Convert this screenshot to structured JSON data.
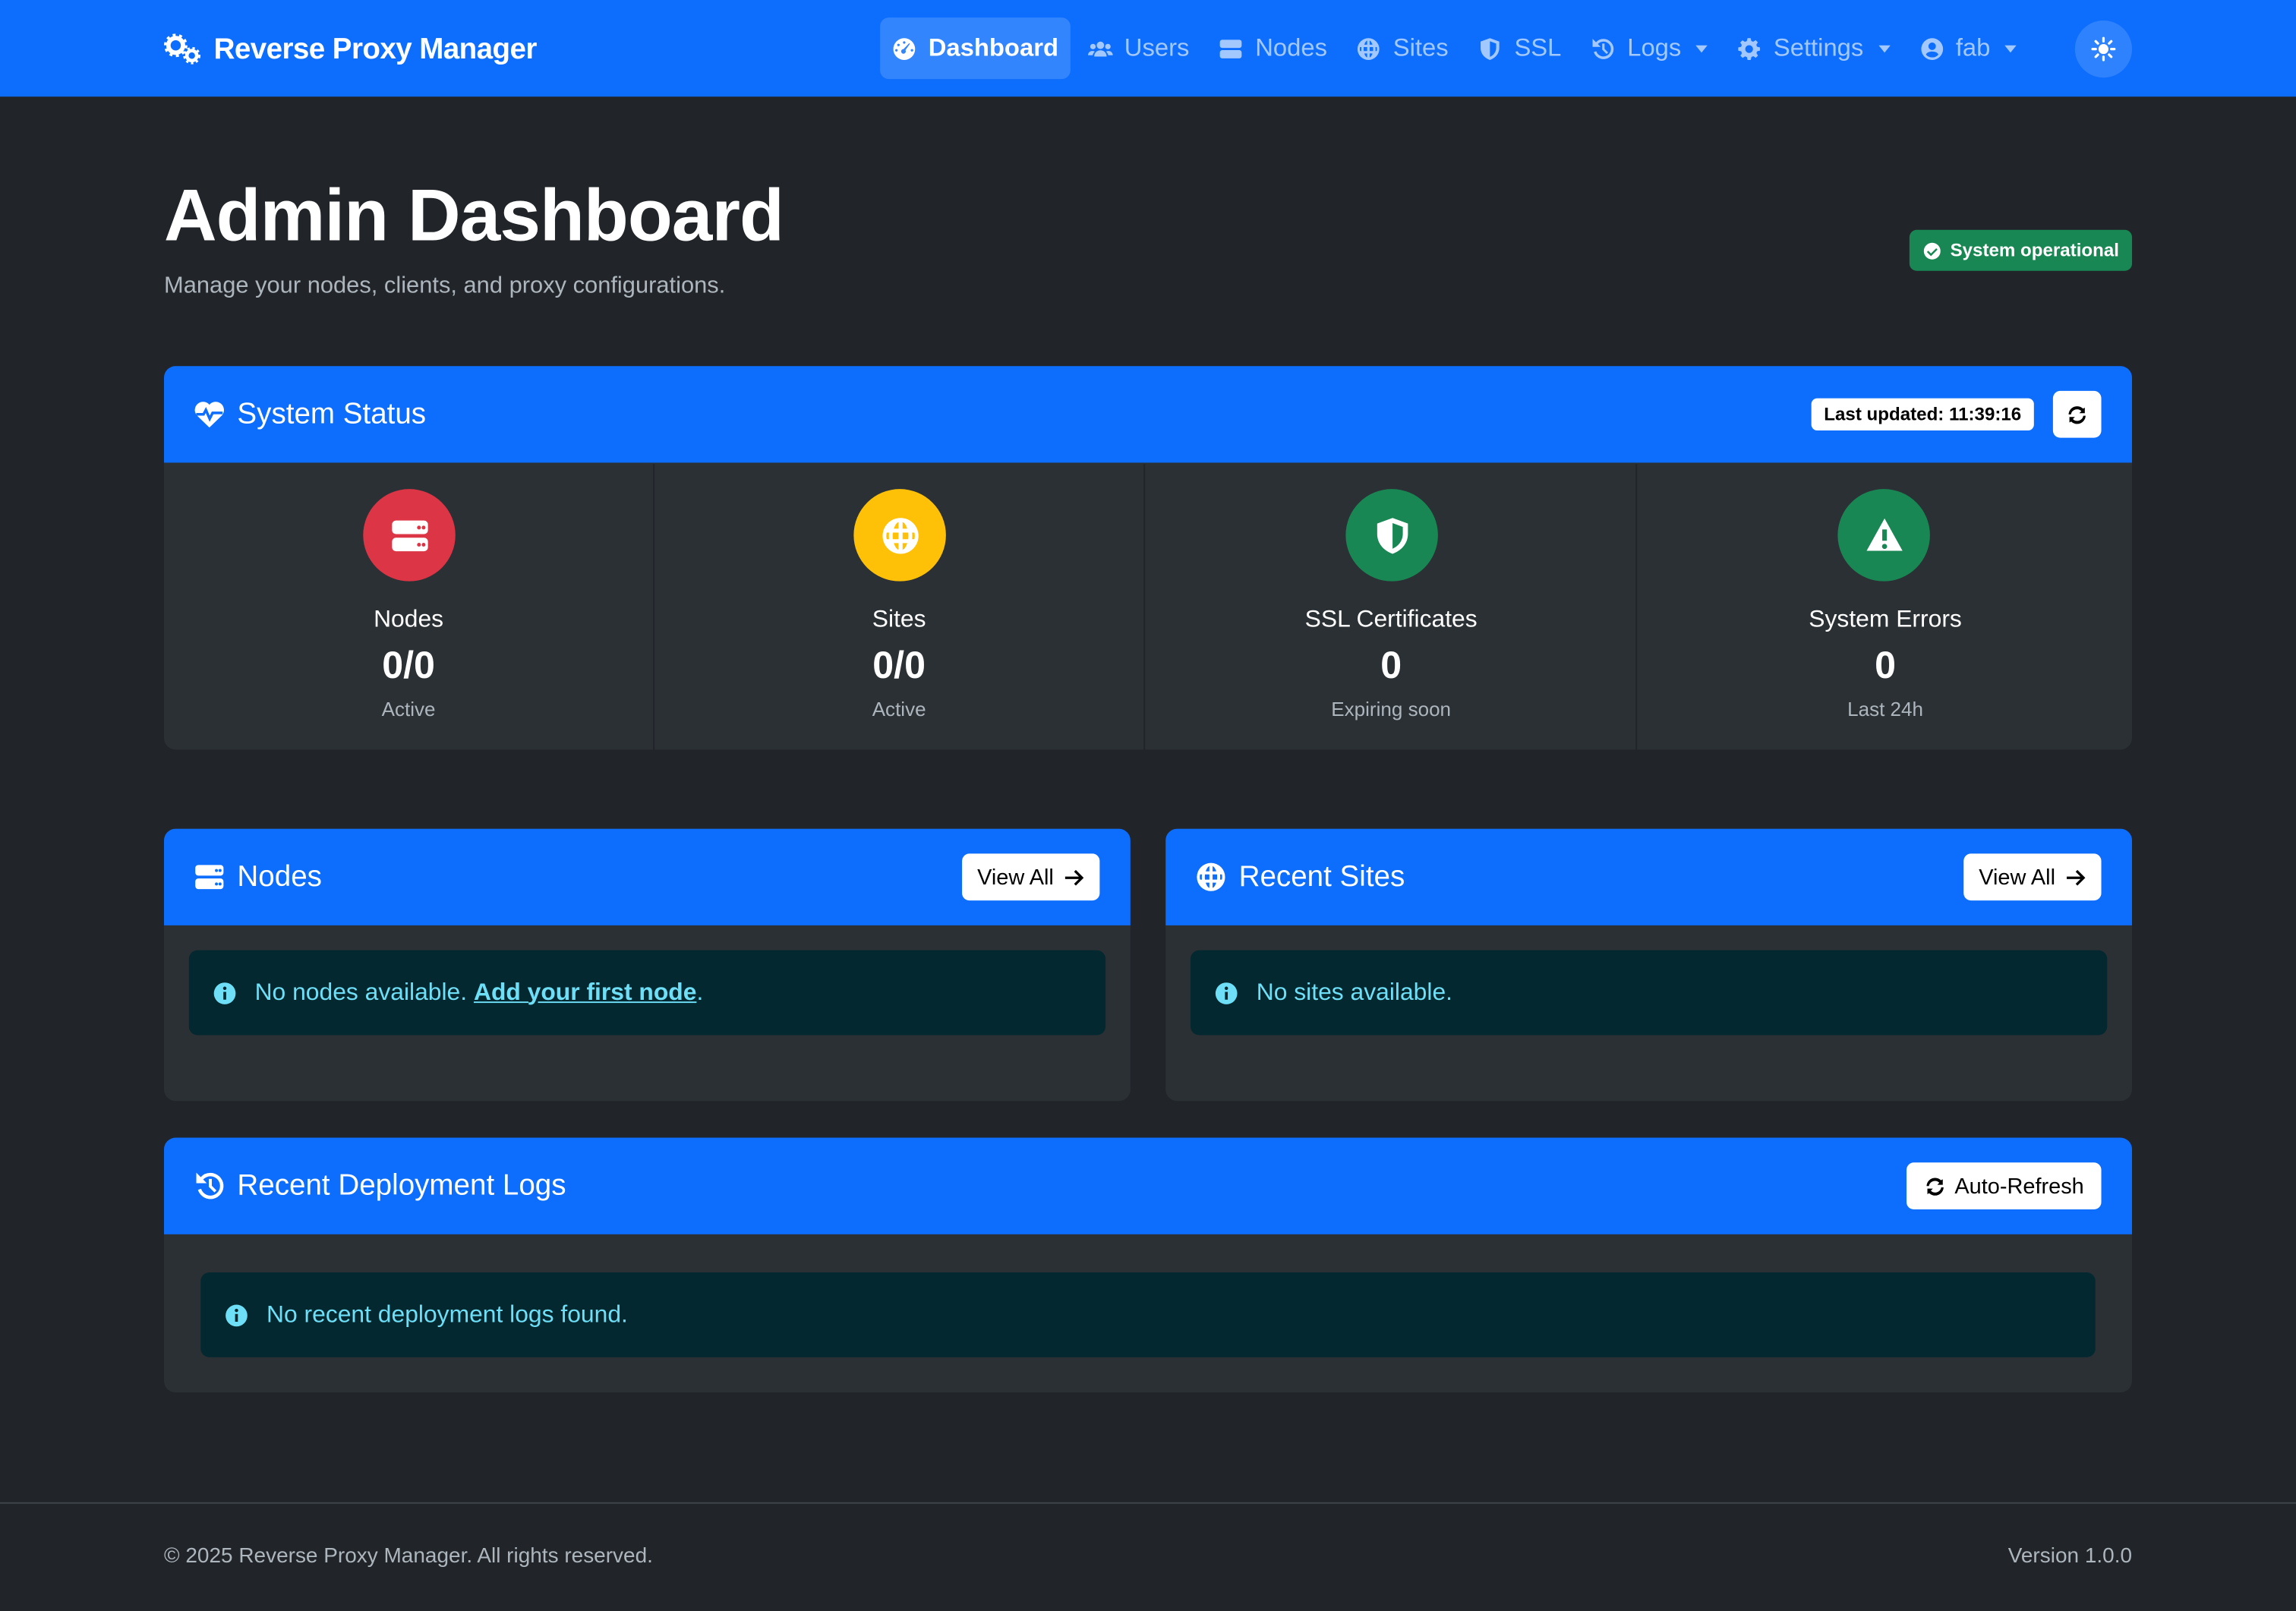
{
  "app": {
    "brand": "Reverse Proxy Manager"
  },
  "nav": {
    "items": [
      {
        "label": "Dashboard",
        "icon": "dashboard-icon",
        "active": true
      },
      {
        "label": "Users",
        "icon": "users-icon"
      },
      {
        "label": "Nodes",
        "icon": "server-icon"
      },
      {
        "label": "Sites",
        "icon": "globe-icon"
      },
      {
        "label": "SSL",
        "icon": "shield-icon"
      },
      {
        "label": "Logs",
        "icon": "history-icon",
        "dropdown": true
      },
      {
        "label": "Settings",
        "icon": "gear-icon",
        "dropdown": true
      },
      {
        "label": "fab",
        "icon": "user-circle-icon",
        "dropdown": true
      }
    ],
    "theme_toggle_icon": "sun-icon"
  },
  "header": {
    "title": "Admin Dashboard",
    "subtitle": "Manage your nodes, clients, and proxy configurations.",
    "status_badge": "System operational"
  },
  "system_status": {
    "title": "System Status",
    "last_updated": "Last updated: 11:39:16",
    "stats": [
      {
        "label": "Nodes",
        "value": "0/0",
        "sub": "Active",
        "color": "#dc3545",
        "icon": "server-icon"
      },
      {
        "label": "Sites",
        "value": "0/0",
        "sub": "Active",
        "color": "#ffc107",
        "icon": "globe-icon"
      },
      {
        "label": "SSL Certificates",
        "value": "0",
        "sub": "Expiring soon",
        "color": "#198754",
        "icon": "shield-icon"
      },
      {
        "label": "System Errors",
        "value": "0",
        "sub": "Last 24h",
        "color": "#198754",
        "icon": "warning-icon"
      }
    ]
  },
  "nodes_card": {
    "title": "Nodes",
    "view_all": "View All",
    "empty_text": "No nodes available.",
    "empty_link": "Add your first node",
    "empty_suffix": "."
  },
  "sites_card": {
    "title": "Recent Sites",
    "view_all": "View All",
    "empty_text": "No sites available."
  },
  "logs_card": {
    "title": "Recent Deployment Logs",
    "auto_refresh": "Auto-Refresh",
    "empty_text": "No recent deployment logs found."
  },
  "footer": {
    "copyright": "© 2025 Reverse Proxy Manager. All rights reserved.",
    "version": "Version 1.0.0"
  },
  "colors": {
    "primary": "#0d6efd",
    "success": "#198754",
    "danger": "#dc3545",
    "warning": "#ffc107",
    "info_text": "#6edff6"
  }
}
